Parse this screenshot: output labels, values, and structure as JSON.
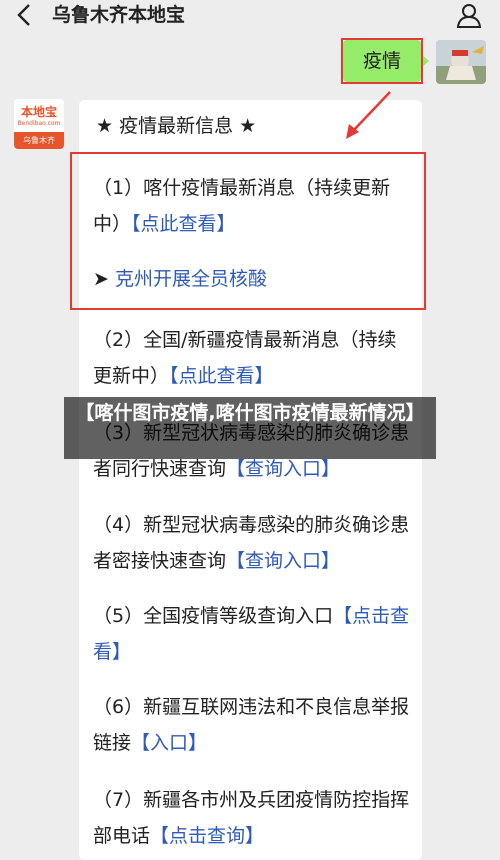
{
  "header": {
    "title": "乌鲁木齐本地宝",
    "back_icon": "chevron-left-icon",
    "profile_icon": "person-icon"
  },
  "chat": {
    "user_message": "疫情",
    "bot_avatar": {
      "logo_text": "本地宝",
      "logo_url": "Bendibao.com",
      "logo_sub": "乌鲁木齐"
    },
    "card_title": "★ 疫情最新信息 ★",
    "items": [
      {
        "text": "（1）喀什疫情最新消息（持续更新中）",
        "link": "【点此查看】"
      },
      {
        "arrow": "➤",
        "link": "克州开展全员核酸"
      },
      {
        "text": "（2）全国/新疆疫情最新消息（持续更新中）",
        "link": "【点此查看】"
      },
      {
        "text": "（3）新型冠状病毒感染的肺炎确诊患者同行快速查询",
        "link": "【查询入口】"
      },
      {
        "text": "（4）新型冠状病毒感染的肺炎确诊患者密接快速查询",
        "link": "【查询入口】"
      },
      {
        "text": "（5）全国疫情等级查询入口",
        "link": "【点击查看】"
      },
      {
        "text": "（6）新疆互联网违法和不良信息举报链接",
        "link": "【入口】"
      },
      {
        "text": "（7）新疆各市州及兵团疫情防控指挥部电话",
        "link": "【点击查询】"
      }
    ]
  },
  "overlay": {
    "text": "【喀什图市疫情,喀什图市疫情最新情况】"
  },
  "colors": {
    "bubble": "#95ec69",
    "link": "#2f5bb7",
    "highlight": "#e53935",
    "brand": "#e8542b"
  }
}
